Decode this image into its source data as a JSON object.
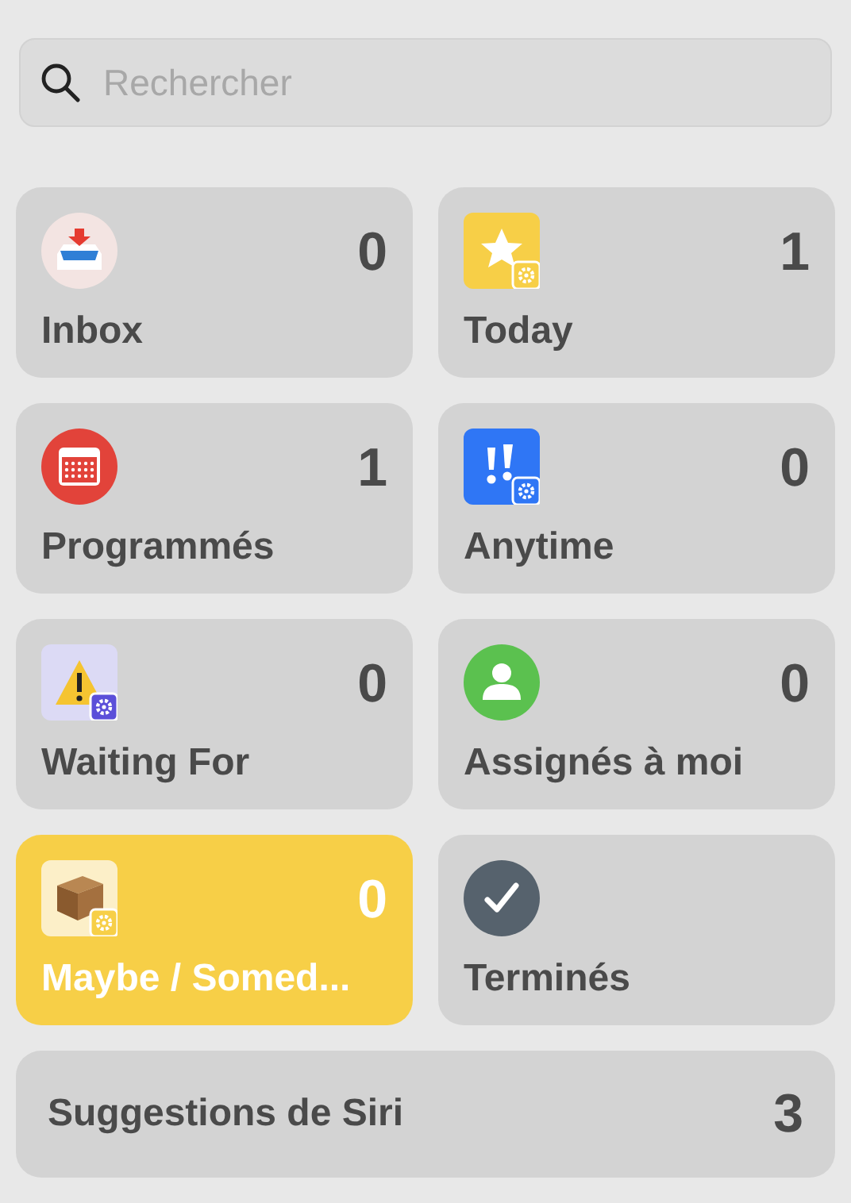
{
  "search": {
    "placeholder": "Rechercher"
  },
  "tiles": [
    {
      "kind": "inbox",
      "label": "Inbox",
      "count": "0",
      "selected": false
    },
    {
      "kind": "today",
      "label": "Today",
      "count": "1",
      "selected": false
    },
    {
      "kind": "scheduled",
      "label": "Programmés",
      "count": "1",
      "selected": false
    },
    {
      "kind": "anytime",
      "label": "Anytime",
      "count": "0",
      "selected": false
    },
    {
      "kind": "waiting",
      "label": "Waiting For",
      "count": "0",
      "selected": false
    },
    {
      "kind": "assigned",
      "label": "Assignés à moi",
      "count": "0",
      "selected": false
    },
    {
      "kind": "maybe",
      "label": "Maybe / Somed...",
      "count": "0",
      "selected": true
    },
    {
      "kind": "done",
      "label": "Terminés",
      "selected": false
    }
  ],
  "suggestions": {
    "label": "Suggestions de Siri",
    "count": "3",
    "selected": false
  }
}
